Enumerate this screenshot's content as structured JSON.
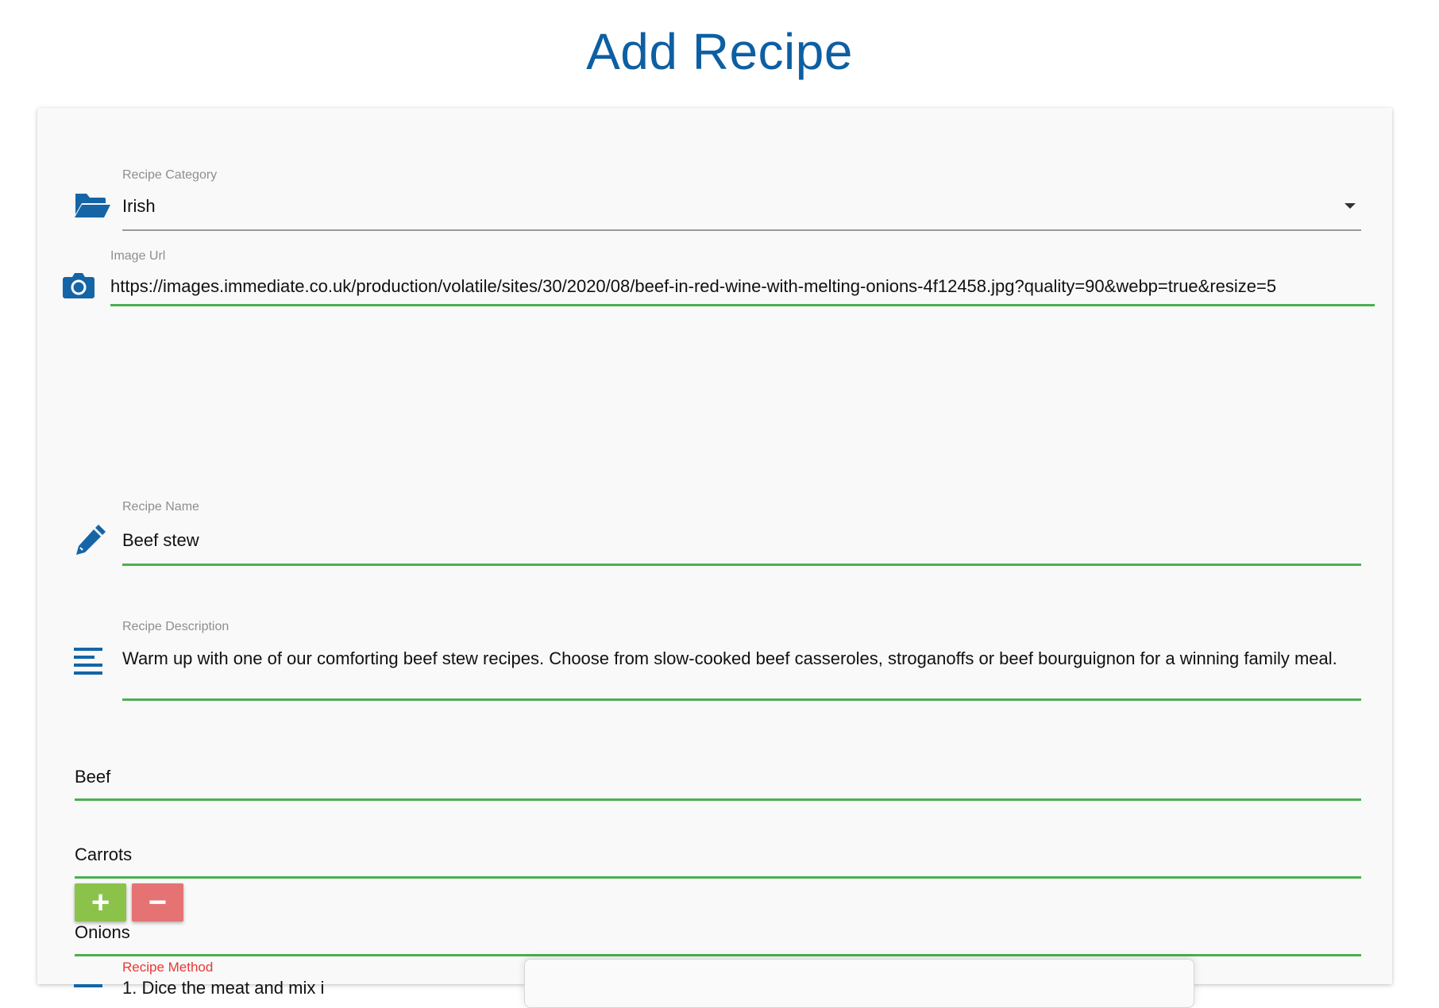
{
  "page": {
    "title": "Add Recipe"
  },
  "form": {
    "category": {
      "label": "Recipe Category",
      "value": "Irish"
    },
    "image_url": {
      "label": "Image Url",
      "value": "https://images.immediate.co.uk/production/volatile/sites/30/2020/08/beef-in-red-wine-with-melting-onions-4f12458.jpg?quality=90&webp=true&resize=5"
    },
    "name": {
      "label": "Recipe Name",
      "value": "Beef stew"
    },
    "description": {
      "label": "Recipe Description",
      "value": "Warm up with one of our comforting beef stew recipes. Choose from slow-cooked beef casseroles, stroganoffs or beef bourguignon for a winning family meal."
    },
    "ingredients": [
      "Beef",
      "Carrots",
      "Onions"
    ],
    "add_button": "+",
    "remove_button": "−",
    "method": {
      "label": "Recipe Method",
      "value": "1. Dice the meat and mix i"
    }
  },
  "colors": {
    "title": "#0d5fa3",
    "icon": "#1565a6",
    "underline_active": "#4caf50",
    "add_button": "#8bc34a",
    "remove_button": "#e57373",
    "method_label": "#e53935"
  },
  "icons": {
    "category": "folder-open-icon",
    "image_url": "camera-icon",
    "name": "pencil-icon",
    "description": "align-left-icon",
    "dropdown": "caret-down-icon"
  }
}
